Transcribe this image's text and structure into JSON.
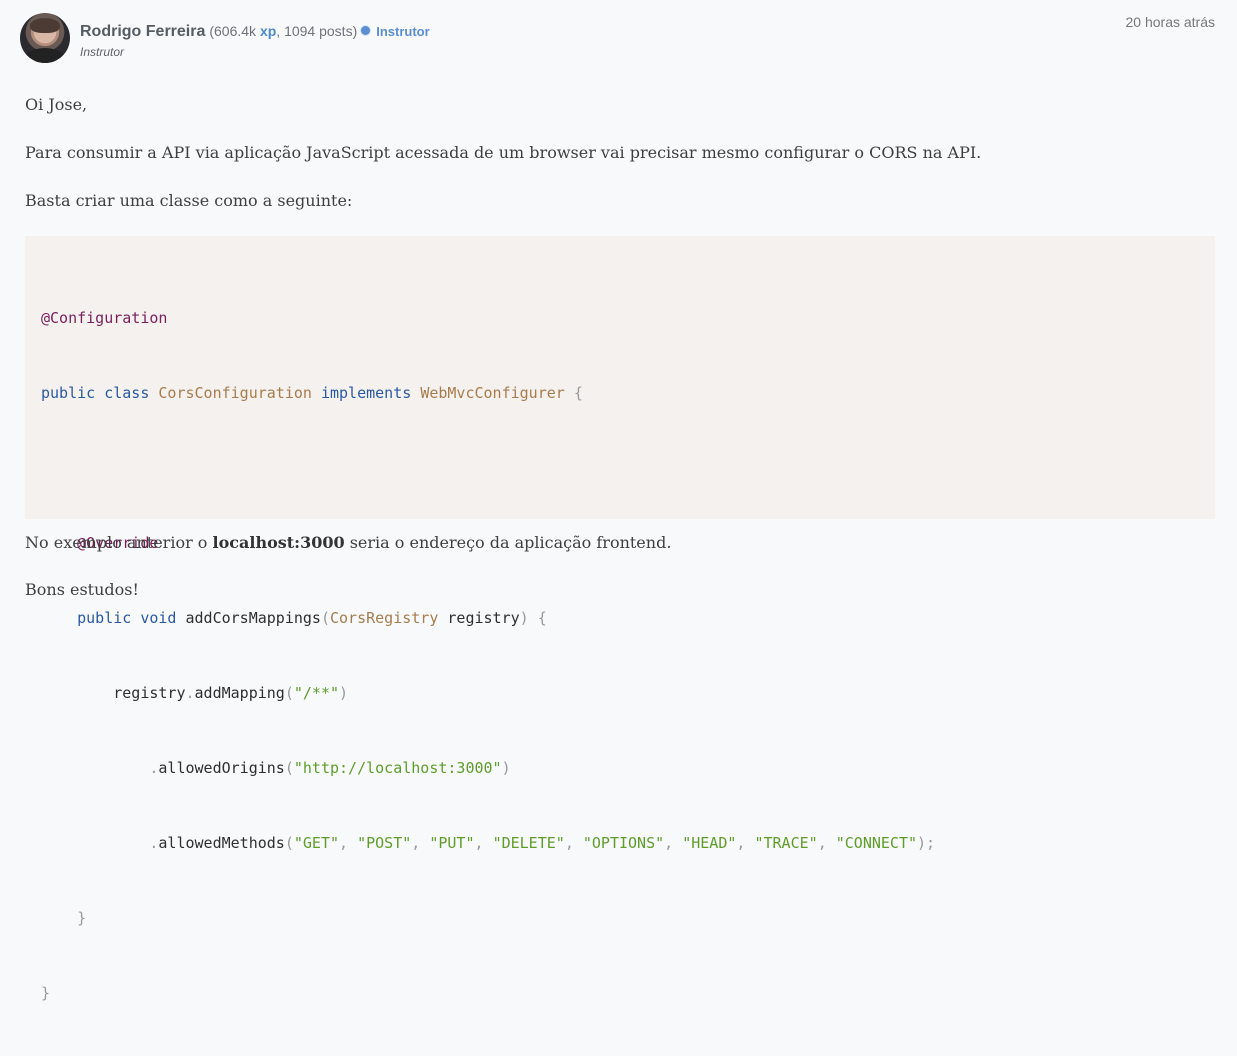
{
  "post": {
    "author": {
      "name": "Rodrigo Ferreira",
      "stats_open": "(606.4k ",
      "xp_label": "xp",
      "stats_close": ", 1094 posts)",
      "badge": "Instrutor",
      "role": "Instrutor"
    },
    "timestamp": "20 horas atrás",
    "paragraphs": {
      "p1": "Oi Jose,",
      "p2": "Para consumir a API via aplicação JavaScript acessada de um browser vai precisar mesmo configurar o CORS na API.",
      "p3": "Basta criar uma classe como a seguinte:",
      "p4_before": "No exemplo anterior o ",
      "p4_bold": "localhost:3000",
      "p4_after": " seria o endereço da aplicação frontend.",
      "p5": "Bons estudos!"
    },
    "code": {
      "line1": "@Configuration",
      "line2": {
        "kw1": "public",
        "kw2": "class",
        "type1": "CorsConfiguration",
        "kw3": "implements",
        "type2": "WebMvcConfigurer",
        "brace": "{"
      },
      "line4": "@Override",
      "line5": {
        "kw1": "public",
        "kw2": "void",
        "method": "addCorsMappings",
        "paren_open": "(",
        "type": "CorsRegistry",
        "param": "registry",
        "paren_close": ")",
        "brace": "{"
      },
      "line6": {
        "obj": "registry",
        "dot": ".",
        "method": "addMapping",
        "paren_open": "(",
        "string": "\"/**\"",
        "paren_close": ")"
      },
      "line7": {
        "dot": ".",
        "method": "allowedOrigins",
        "paren_open": "(",
        "string": "\"http://localhost:3000\"",
        "paren_close": ")"
      },
      "line8": {
        "dot": ".",
        "method": "allowedMethods",
        "paren_open": "(",
        "values": [
          "\"GET\"",
          "\"POST\"",
          "\"PUT\"",
          "\"DELETE\"",
          "\"OPTIONS\"",
          "\"HEAD\"",
          "\"TRACE\"",
          "\"CONNECT\""
        ],
        "paren_close": ");"
      },
      "line9": "}",
      "line10": "}"
    }
  },
  "colors": {
    "annotation": "#7a1f5a",
    "keyword": "#2a59a3",
    "type": "#a77c4d",
    "string": "#5e9e28",
    "badge": "#5b8fd2"
  },
  "icons": {
    "badge_icon": "gear-icon"
  }
}
